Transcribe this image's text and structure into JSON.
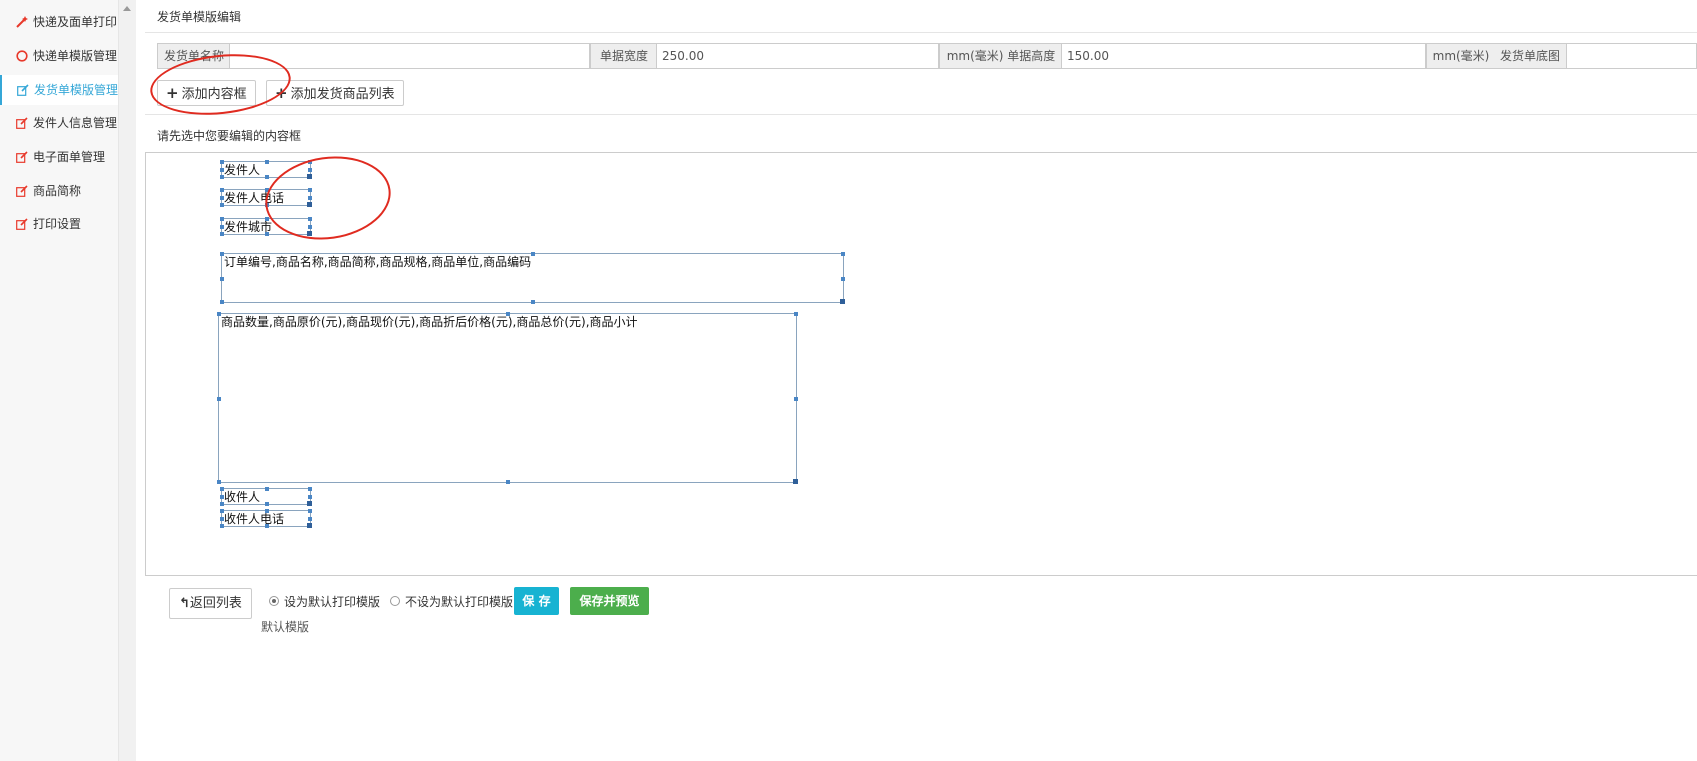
{
  "sidebar": {
    "items": [
      {
        "label": "快递及面单打印",
        "icon": "magic-wand-icon"
      },
      {
        "label": "快递单模版管理",
        "icon": "circle-icon"
      },
      {
        "label": "发货单模版管理",
        "icon": "edit-icon"
      },
      {
        "label": "发件人信息管理",
        "icon": "edit-icon"
      },
      {
        "label": "电子面单管理",
        "icon": "edit-icon"
      },
      {
        "label": "商品简称",
        "icon": "edit-icon"
      },
      {
        "label": "打印设置",
        "icon": "edit-icon"
      }
    ],
    "active_index": 2
  },
  "header": {
    "title": "发货单模版编辑"
  },
  "form": {
    "name_label": "发货单名称",
    "name_value": "",
    "width_label": "单据宽度",
    "width_value": "250.00",
    "height_label": "mm(毫米) 单据高度",
    "height_value": "150.00",
    "bg_label_unit": "mm(毫米)",
    "bg_label": "发货单底图"
  },
  "toolbar": {
    "add_box_label": "添加内容框",
    "add_goods_label": "添加发货商品列表"
  },
  "hint": "请先选中您要编辑的内容框",
  "canvas": {
    "boxes": [
      {
        "text": "发件人"
      },
      {
        "text": "发件人电话"
      },
      {
        "text": "发件城市"
      },
      {
        "text": "订单编号,商品名称,商品简称,商品规格,商品单位,商品编码"
      },
      {
        "text": "商品数量,商品原价(元),商品现价(元),商品折后价格(元),商品总价(元),商品小计"
      },
      {
        "text": "收件人"
      },
      {
        "text": "收件人电话"
      }
    ]
  },
  "bottom": {
    "back_label": "返回列表",
    "radio_default_label": "设为默认打印模版",
    "radio_not_default_label": "不设为默认打印模版",
    "save_label": "保 存",
    "save_preview_label": "保存并预览",
    "default_note": "默认模版"
  },
  "colors": {
    "accent": "#35a7d7",
    "save_button": "#17b3d2",
    "save_preview_button": "#4cae4c",
    "annotation_ellipse": "#e02b20",
    "icon_red": "#e8392b"
  }
}
